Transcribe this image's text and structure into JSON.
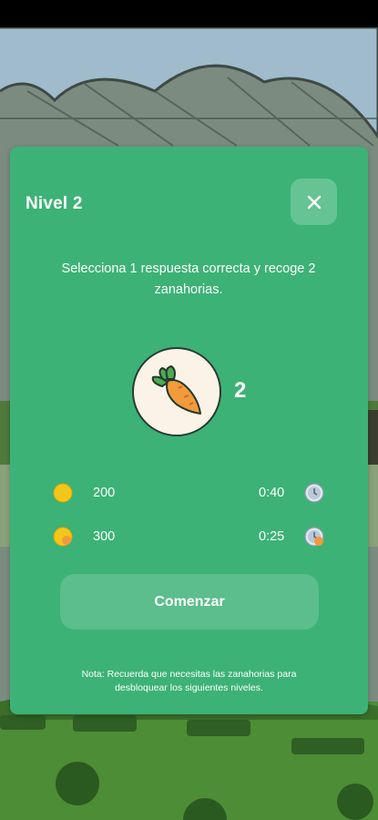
{
  "modal": {
    "title": "Nivel 2",
    "instructions": "Selecciona 1 respuesta correcta y recoge 2 zanahorias.",
    "carrot_count": "2",
    "rows": [
      {
        "coins": "200",
        "time": "0:40"
      },
      {
        "coins": "300",
        "time": "0:25"
      }
    ],
    "start_label": "Comenzar",
    "note": "Nota: Recuerda que necesitas las zanahorias para desbloquear los siguientes niveles."
  },
  "colors": {
    "modal_bg": "#3cb276",
    "coin": "#f5c518",
    "carrot": "#f29b3c",
    "leaf": "#4caa52"
  },
  "icons": [
    "close-icon",
    "carrot-icon",
    "coin-icon",
    "coin-bonus-icon",
    "clock-icon",
    "clock-bonus-icon"
  ]
}
